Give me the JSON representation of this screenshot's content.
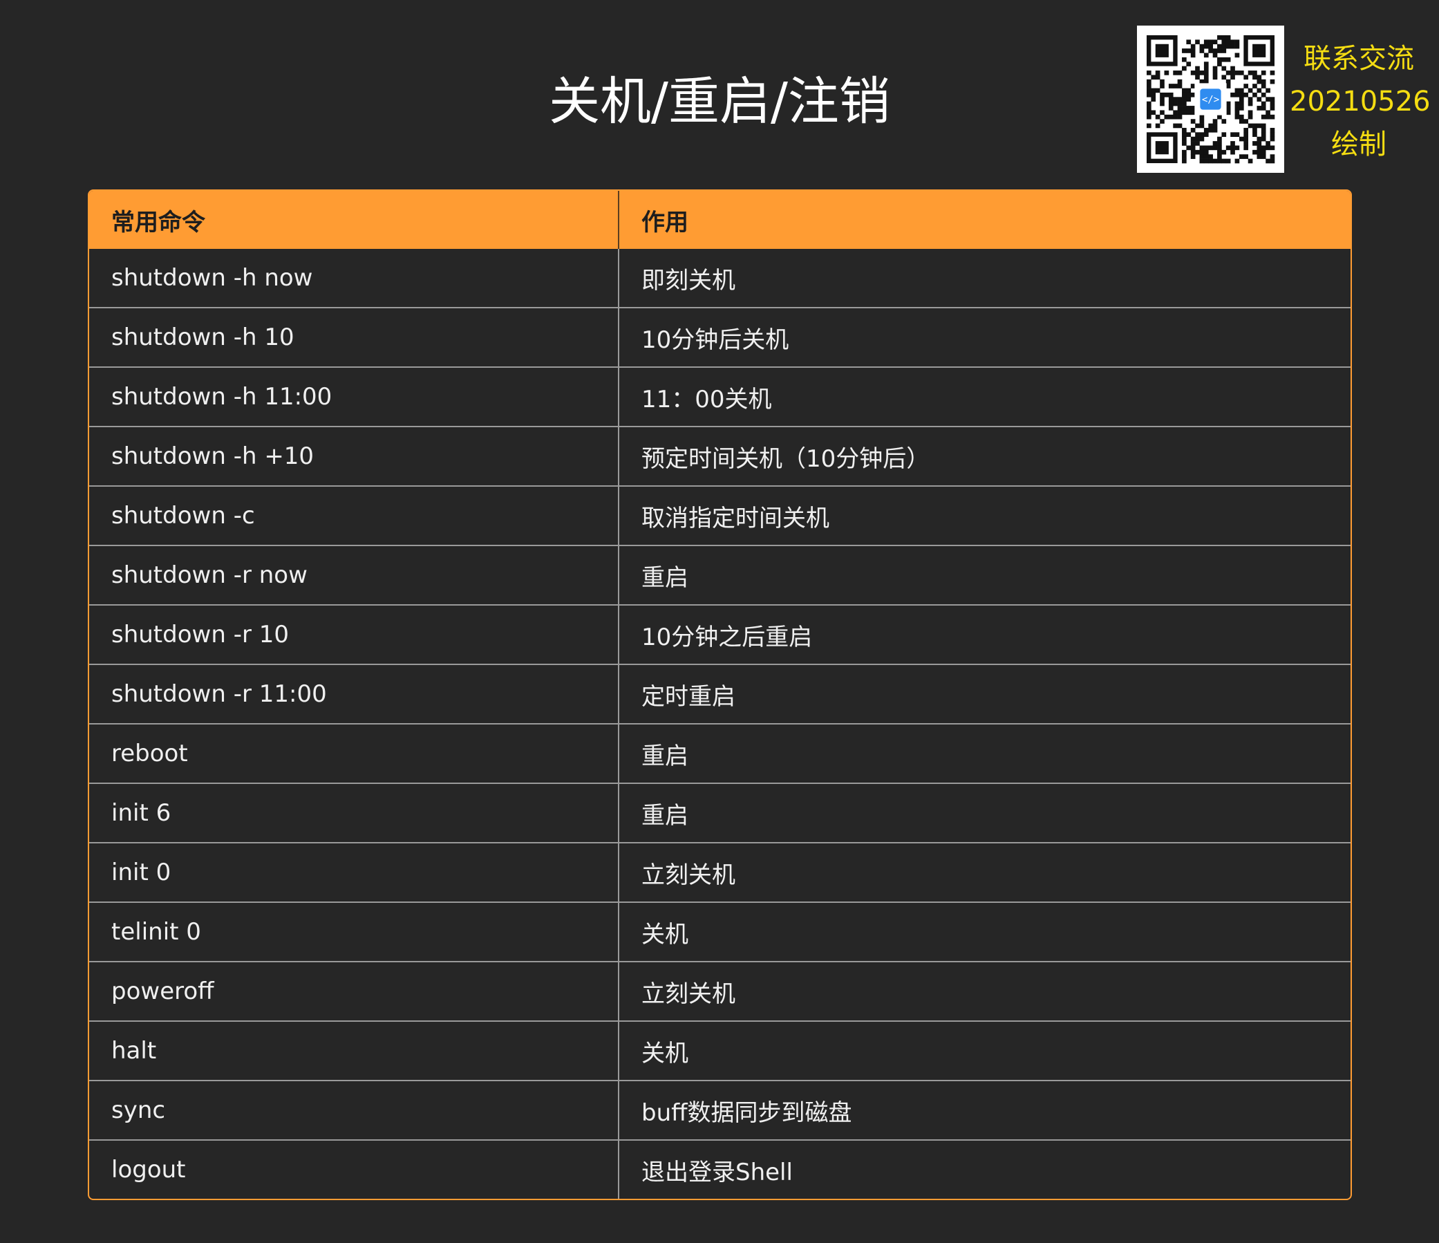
{
  "title": "关机/重启/注销",
  "contact": {
    "line1": "联系交流",
    "line2": "20210526",
    "line3": "绘制"
  },
  "colors": {
    "background": "#262626",
    "header": "#ff9c33",
    "accent_text": "#f5dd12"
  },
  "qr_icon": "qr-code-icon",
  "table": {
    "headers": [
      "常用命令",
      "作用"
    ],
    "rows": [
      [
        "shutdown -h now",
        "即刻关机"
      ],
      [
        "shutdown -h 10",
        "10分钟后关机"
      ],
      [
        "shutdown -h 11:00",
        "11：00关机"
      ],
      [
        "shutdown -h +10",
        "预定时间关机（10分钟后）"
      ],
      [
        "shutdown -c",
        "取消指定时间关机"
      ],
      [
        "shutdown -r now",
        "重启"
      ],
      [
        "shutdown -r 10",
        "10分钟之后重启"
      ],
      [
        "shutdown -r 11:00",
        "定时重启"
      ],
      [
        "reboot",
        "重启"
      ],
      [
        "init 6",
        "重启"
      ],
      [
        "init 0",
        "立刻关机"
      ],
      [
        "telinit 0",
        "关机"
      ],
      [
        "poweroff",
        "立刻关机"
      ],
      [
        "halt",
        "关机"
      ],
      [
        "sync",
        "buff数据同步到磁盘"
      ],
      [
        "logout",
        "退出登录Shell"
      ]
    ]
  }
}
